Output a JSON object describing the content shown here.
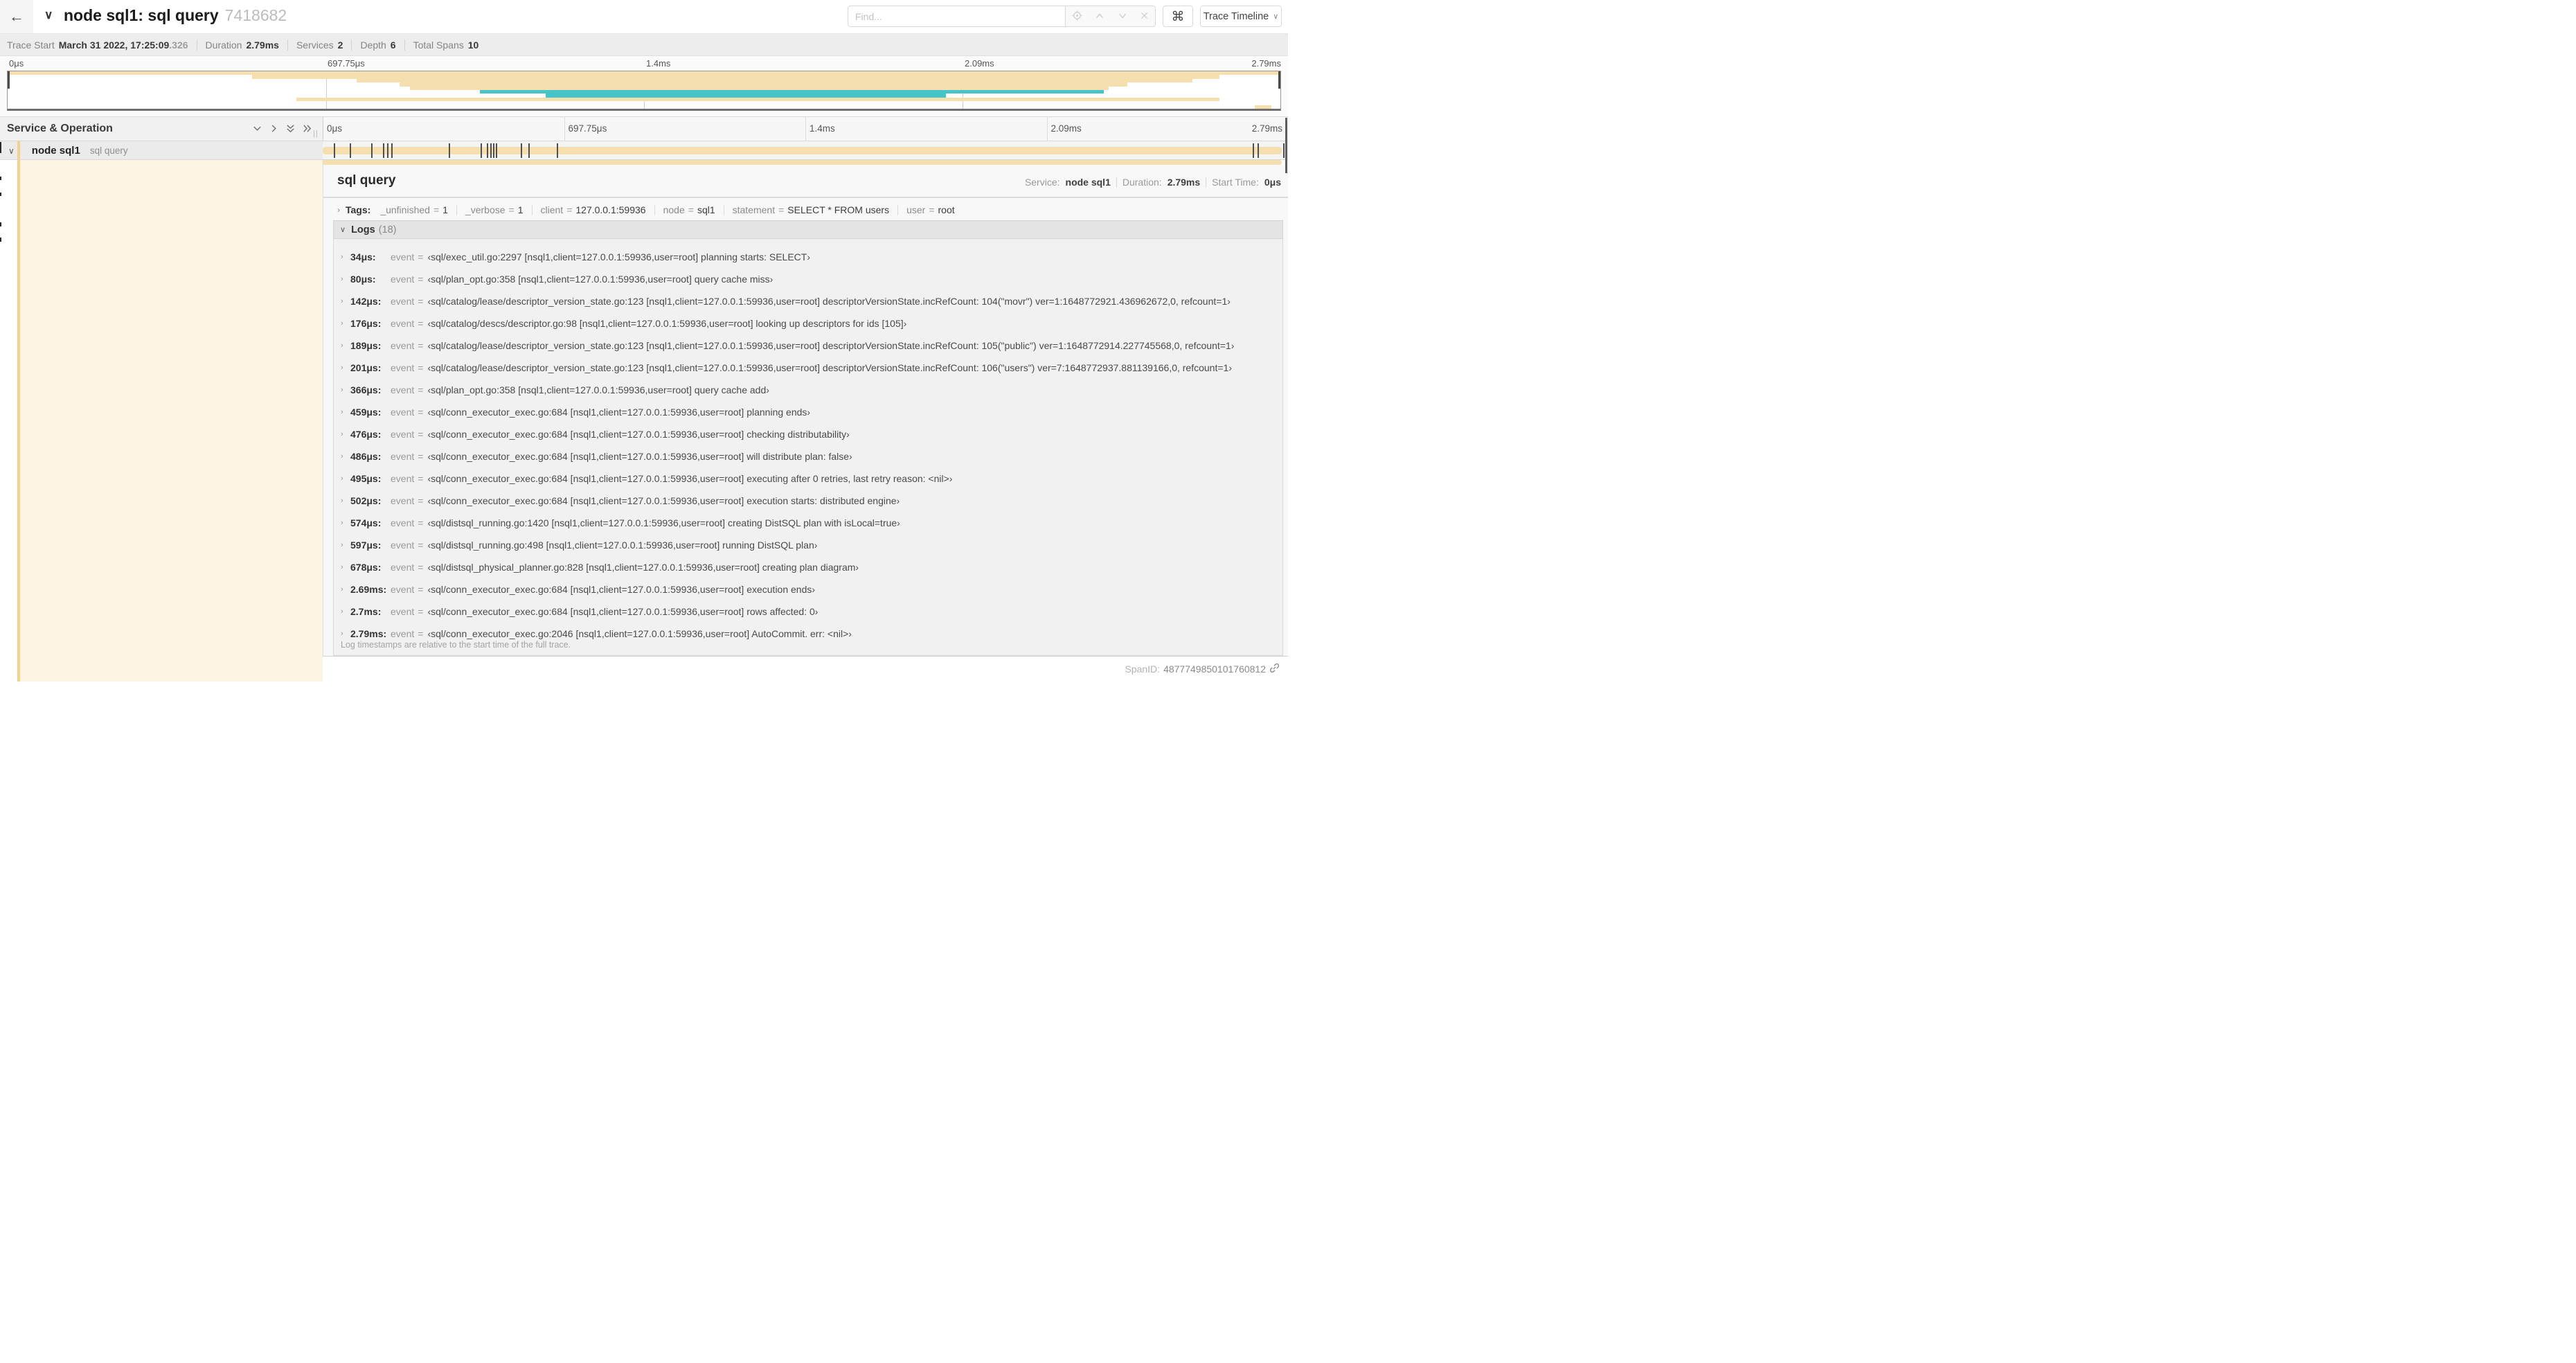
{
  "header": {
    "back_icon": "←",
    "collapse_icon": "∨",
    "title": "node sql1: sql query",
    "trace_id": "7418682",
    "find_placeholder": "Find...",
    "shortcut_button": "⌘",
    "view_button": "Trace Timeline",
    "view_button_chevron": "∨"
  },
  "trace_info": {
    "items": [
      {
        "label": "Trace Start",
        "value": "March 31 2022, 17:25:09",
        "suffix": ".326"
      },
      {
        "label": "Duration",
        "value": "2.79ms"
      },
      {
        "label": "Services",
        "value": "2"
      },
      {
        "label": "Depth",
        "value": "6"
      },
      {
        "label": "Total Spans",
        "value": "10"
      }
    ]
  },
  "minimap": {
    "tick_labels": [
      "0μs",
      "697.75μs",
      "1.4ms",
      "2.09ms",
      "2.79ms"
    ],
    "colors": {
      "span": "#f5dfae",
      "remote_span": "#45c5c9"
    },
    "rows": [
      {
        "start": 0,
        "end": 100,
        "color": "tan"
      },
      {
        "start": 19.2,
        "end": 95.2,
        "color": "tan"
      },
      {
        "start": 27.4,
        "end": 93.1,
        "color": "tan"
      },
      {
        "start": 30.8,
        "end": 88.0,
        "color": "tan"
      },
      {
        "start": 31.6,
        "end": 86.5,
        "color": "tan"
      },
      {
        "start": 37.1,
        "end": 86.1,
        "color": "teal"
      },
      {
        "start": 42.3,
        "end": 73.7,
        "color": "teal"
      },
      {
        "start": 22.7,
        "end": 95.2,
        "color": "tan"
      },
      {
        "start": 0,
        "end": 0,
        "color": "none"
      },
      {
        "start": 98.0,
        "end": 99.3,
        "color": "tan"
      }
    ]
  },
  "timeline": {
    "header": "Service & Operation",
    "ruler_ticks": [
      "0μs",
      "697.75μs",
      "1.4ms",
      "2.09ms",
      "2.79ms"
    ],
    "row": {
      "collapse_icon": "∨",
      "service": "node sql1",
      "operation": "sql query",
      "log_tick_pcts": [
        1.22,
        2.87,
        5.09,
        6.31,
        6.77,
        7.2,
        13.12,
        16.45,
        17.06,
        17.42,
        17.74,
        18.0,
        20.57,
        21.4,
        24.3,
        96.4,
        96.95,
        99.6
      ]
    }
  },
  "detail": {
    "title": "sql query",
    "meta": [
      {
        "label": "Service:",
        "value": "node sql1"
      },
      {
        "label": "Duration:",
        "value": "2.79ms"
      },
      {
        "label": "Start Time:",
        "value": "0μs"
      }
    ],
    "tags_title": "Tags:",
    "tags": [
      {
        "key": "_unfinished",
        "value": "1"
      },
      {
        "key": "_verbose",
        "value": "1"
      },
      {
        "key": "client",
        "value": "127.0.0.1:59936"
      },
      {
        "key": "node",
        "value": "sql1"
      },
      {
        "key": "statement",
        "value": "SELECT * FROM users"
      },
      {
        "key": "user",
        "value": "root"
      }
    ],
    "logs_title": "Logs",
    "logs_count": "(18)",
    "log_field_key": "event",
    "logs": [
      {
        "time": "34μs:",
        "value": "‹sql/exec_util.go:2297 [nsql1,client=127.0.0.1:59936,user=root] planning starts: SELECT›"
      },
      {
        "time": "80μs:",
        "value": "‹sql/plan_opt.go:358 [nsql1,client=127.0.0.1:59936,user=root] query cache miss›"
      },
      {
        "time": "142μs:",
        "value": "‹sql/catalog/lease/descriptor_version_state.go:123 [nsql1,client=127.0.0.1:59936,user=root] descriptorVersionState.incRefCount: 104(\"movr\") ver=1:1648772921.436962672,0, refcount=1›"
      },
      {
        "time": "176μs:",
        "value": "‹sql/catalog/descs/descriptor.go:98 [nsql1,client=127.0.0.1:59936,user=root] looking up descriptors for ids [105]›"
      },
      {
        "time": "189μs:",
        "value": "‹sql/catalog/lease/descriptor_version_state.go:123 [nsql1,client=127.0.0.1:59936,user=root] descriptorVersionState.incRefCount: 105(\"public\") ver=1:1648772914.227745568,0, refcount=1›"
      },
      {
        "time": "201μs:",
        "value": "‹sql/catalog/lease/descriptor_version_state.go:123 [nsql1,client=127.0.0.1:59936,user=root] descriptorVersionState.incRefCount: 106(\"users\") ver=7:1648772937.881139166,0, refcount=1›"
      },
      {
        "time": "366μs:",
        "value": "‹sql/plan_opt.go:358 [nsql1,client=127.0.0.1:59936,user=root] query cache add›"
      },
      {
        "time": "459μs:",
        "value": "‹sql/conn_executor_exec.go:684 [nsql1,client=127.0.0.1:59936,user=root] planning ends›"
      },
      {
        "time": "476μs:",
        "value": "‹sql/conn_executor_exec.go:684 [nsql1,client=127.0.0.1:59936,user=root] checking distributability›"
      },
      {
        "time": "486μs:",
        "value": "‹sql/conn_executor_exec.go:684 [nsql1,client=127.0.0.1:59936,user=root] will distribute plan: false›"
      },
      {
        "time": "495μs:",
        "value": "‹sql/conn_executor_exec.go:684 [nsql1,client=127.0.0.1:59936,user=root] executing after 0 retries, last retry reason: <nil>›"
      },
      {
        "time": "502μs:",
        "value": "‹sql/conn_executor_exec.go:684 [nsql1,client=127.0.0.1:59936,user=root] execution starts: distributed engine›"
      },
      {
        "time": "574μs:",
        "value": "‹sql/distsql_running.go:1420 [nsql1,client=127.0.0.1:59936,user=root] creating DistSQL plan with isLocal=true›"
      },
      {
        "time": "597μs:",
        "value": "‹sql/distsql_running.go:498 [nsql1,client=127.0.0.1:59936,user=root] running DistSQL plan›"
      },
      {
        "time": "678μs:",
        "value": "‹sql/distsql_physical_planner.go:828 [nsql1,client=127.0.0.1:59936,user=root] creating plan diagram›"
      },
      {
        "time": "2.69ms:",
        "value": "‹sql/conn_executor_exec.go:684 [nsql1,client=127.0.0.1:59936,user=root] execution ends›"
      },
      {
        "time": "2.7ms:",
        "value": "‹sql/conn_executor_exec.go:684 [nsql1,client=127.0.0.1:59936,user=root] rows affected: 0›"
      },
      {
        "time": "2.79ms:",
        "value": "‹sql/conn_executor_exec.go:2046 [nsql1,client=127.0.0.1:59936,user=root] AutoCommit. err: <nil>›"
      }
    ],
    "logs_note": "Log timestamps are relative to the start time of the full trace.",
    "spanid_label": "SpanID:",
    "spanid_value": "4877749850101760812"
  }
}
